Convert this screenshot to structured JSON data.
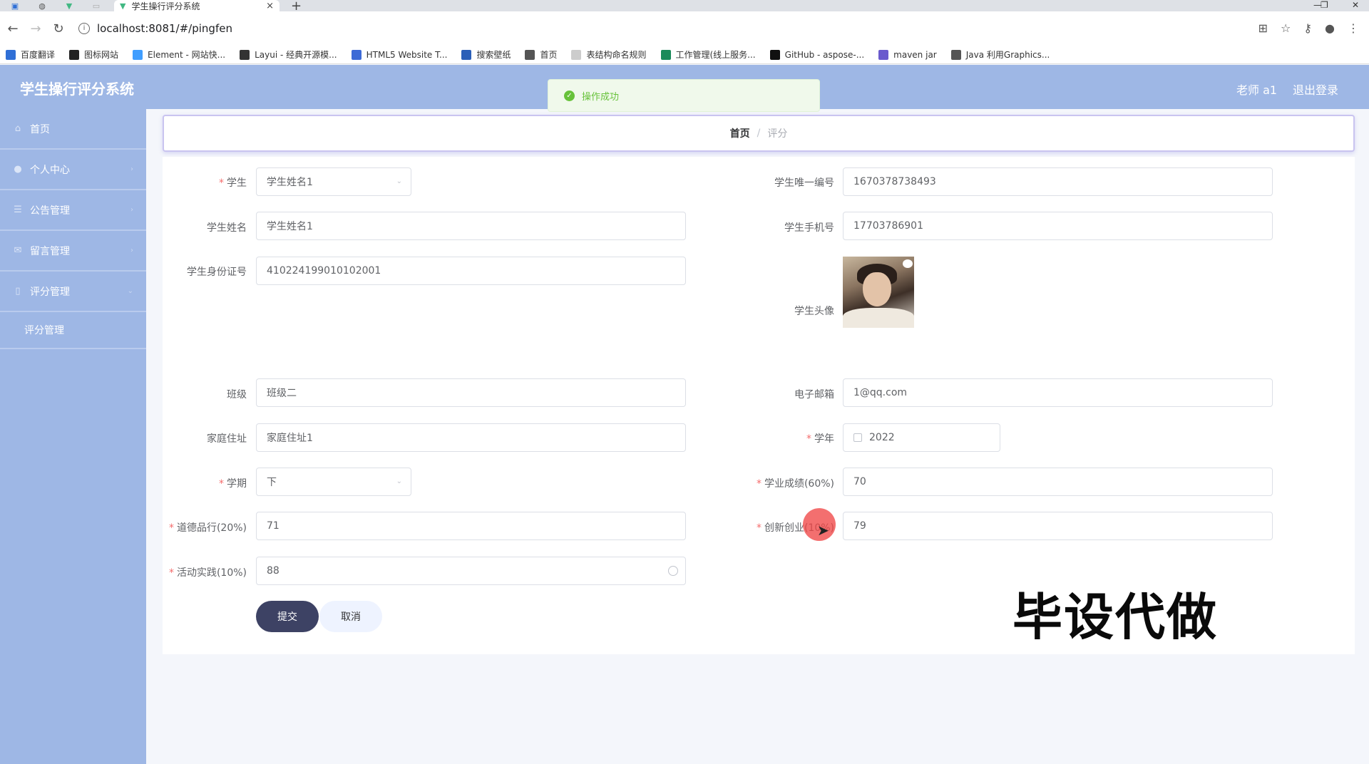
{
  "browser": {
    "tab_title": "学生操行评分系统",
    "tab_close": "×",
    "new_tab": "+",
    "url": "localhost:8081/#/pingfen",
    "bookmarks": [
      {
        "label": "百度翻译",
        "color": "#2f6fd6"
      },
      {
        "label": "图标网站",
        "color": "#222222"
      },
      {
        "label": "Element - 网站快...",
        "color": "#409eff"
      },
      {
        "label": "Layui - 经典开源模...",
        "color": "#333333"
      },
      {
        "label": "HTML5 Website T...",
        "color": "#3d6ad6"
      },
      {
        "label": "搜索壁纸",
        "color": "#2b5fb8"
      },
      {
        "label": "首页",
        "color": "#555555"
      },
      {
        "label": "表结构命名规则",
        "color": "#cccccc"
      },
      {
        "label": "工作管理(线上服务...",
        "color": "#1b8a5a"
      },
      {
        "label": "GitHub - aspose-...",
        "color": "#111111"
      },
      {
        "label": "maven jar",
        "color": "#6a5acd"
      },
      {
        "label": "Java 利用Graphics...",
        "color": "#555555"
      }
    ]
  },
  "header": {
    "title": "学生操行评分系统",
    "user": "老师 a1",
    "logout": "退出登录"
  },
  "toast": {
    "message": "操作成功",
    "color": "#67c23a"
  },
  "sidebar": {
    "items": [
      {
        "label": "首页",
        "icon": "home-icon"
      },
      {
        "label": "个人中心",
        "icon": "user-icon"
      },
      {
        "label": "公告管理",
        "icon": "list-icon"
      },
      {
        "label": "留言管理",
        "icon": "message-icon"
      },
      {
        "label": "评分管理",
        "icon": "score-icon"
      }
    ],
    "sub_item": "评分管理"
  },
  "breadcrumb": {
    "home": "首页",
    "separator": "/",
    "current": "评分"
  },
  "form": {
    "student": {
      "label": "学生",
      "value": "学生姓名1"
    },
    "student_id": {
      "label": "学生唯一编号",
      "value": "1670378738493"
    },
    "student_name": {
      "label": "学生姓名",
      "value": "学生姓名1"
    },
    "student_phone": {
      "label": "学生手机号",
      "value": "17703786901"
    },
    "student_idcard": {
      "label": "学生身份证号",
      "value": "410224199010102001"
    },
    "student_avatar": {
      "label": "学生头像"
    },
    "class": {
      "label": "班级",
      "value": "班级二"
    },
    "email": {
      "label": "电子邮箱",
      "value": "1@qq.com"
    },
    "address": {
      "label": "家庭住址",
      "value": "家庭住址1"
    },
    "year": {
      "label": "学年",
      "value": "2022"
    },
    "term": {
      "label": "学期",
      "value": "下"
    },
    "academic": {
      "label": "学业成绩(60%)",
      "value": "70"
    },
    "morality": {
      "label": "道德品行(20%)",
      "value": "71"
    },
    "innovation": {
      "label": "创新创业(10%)",
      "value": "79"
    },
    "activity": {
      "label": "活动实践(10%)",
      "value": "88"
    },
    "submit": "提交",
    "cancel": "取消"
  },
  "watermark": "毕设代做",
  "colors": {
    "header_bg": "#9eb7e5",
    "submit_bg": "#3d4264",
    "required": "#f56c6c"
  }
}
